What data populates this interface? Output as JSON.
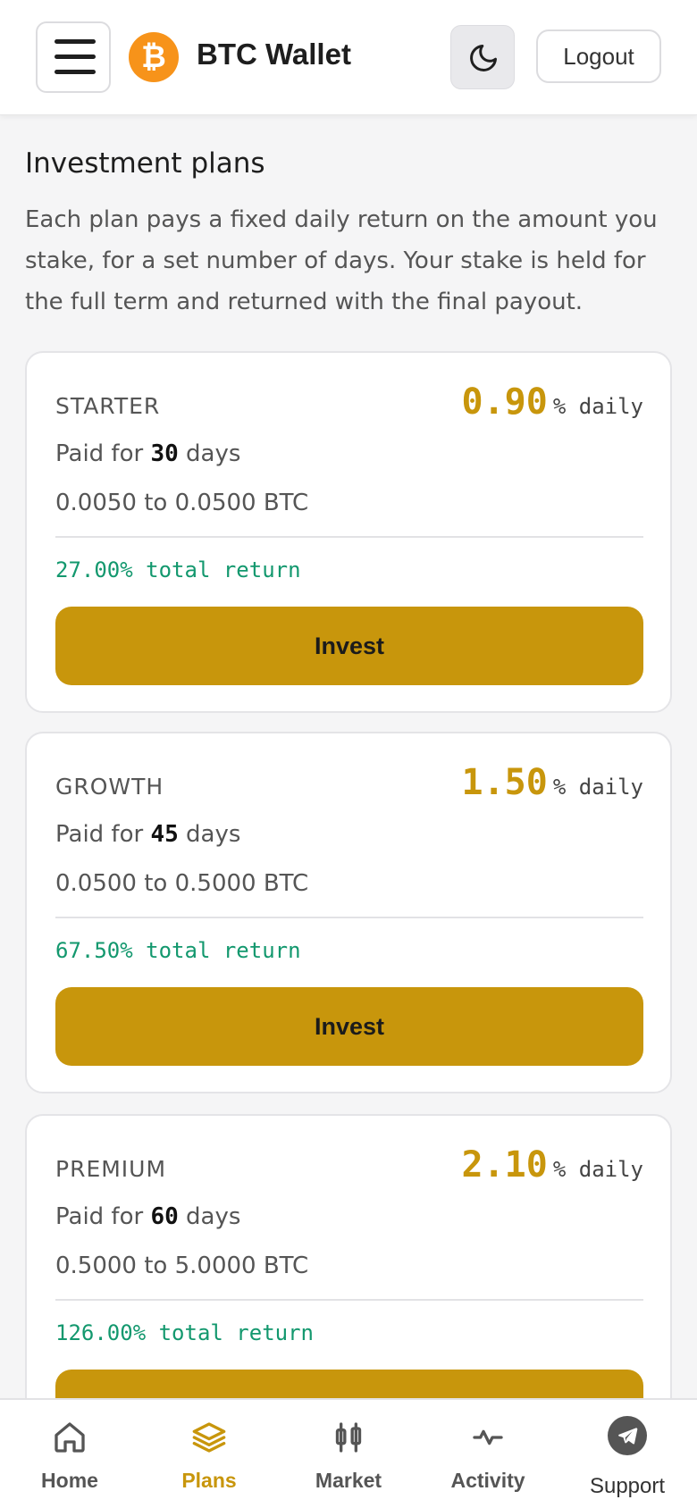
{
  "header": {
    "app_title": "BTC Wallet",
    "logo_glyph": "₿",
    "logout_label": "Logout",
    "theme_icon": "moon-icon",
    "menu_icon": "hamburger-icon"
  },
  "page": {
    "title": "Investment plans",
    "description": "Each plan pays a fixed daily return on the amount you stake, for a set number of days. Your stake is held for the full term and returned with the final payout."
  },
  "plans": [
    {
      "name": "STARTER",
      "rate": "0.90",
      "rate_unit": "% daily",
      "paid_prefix": "Paid for ",
      "days": "30",
      "days_suffix": " days",
      "range": "0.0050 to 0.0500 BTC",
      "total": "27.00% total return",
      "button": "Invest"
    },
    {
      "name": "GROWTH",
      "rate": "1.50",
      "rate_unit": "% daily",
      "paid_prefix": "Paid for ",
      "days": "45",
      "days_suffix": " days",
      "range": "0.0500 to 0.5000 BTC",
      "total": "67.50% total return",
      "button": "Invest"
    },
    {
      "name": "PREMIUM",
      "rate": "2.10",
      "rate_unit": "% daily",
      "paid_prefix": "Paid for ",
      "days": "60",
      "days_suffix": " days",
      "range": "0.5000 to 5.0000 BTC",
      "total": "126.00% total return",
      "button": "Invest"
    }
  ],
  "bottom_nav": [
    {
      "label": "Home",
      "icon": "home-icon",
      "active": false
    },
    {
      "label": "Plans",
      "icon": "layers-icon",
      "active": true
    },
    {
      "label": "Market",
      "icon": "candlestick-icon",
      "active": false
    },
    {
      "label": "Activity",
      "icon": "activity-icon",
      "active": false
    },
    {
      "label": "Support",
      "icon": "telegram-icon",
      "active": false
    }
  ],
  "colors": {
    "accent": "#c8960c",
    "bitcoin_orange": "#f7931a",
    "success_green": "#13986e",
    "background": "#f5f5f6"
  }
}
